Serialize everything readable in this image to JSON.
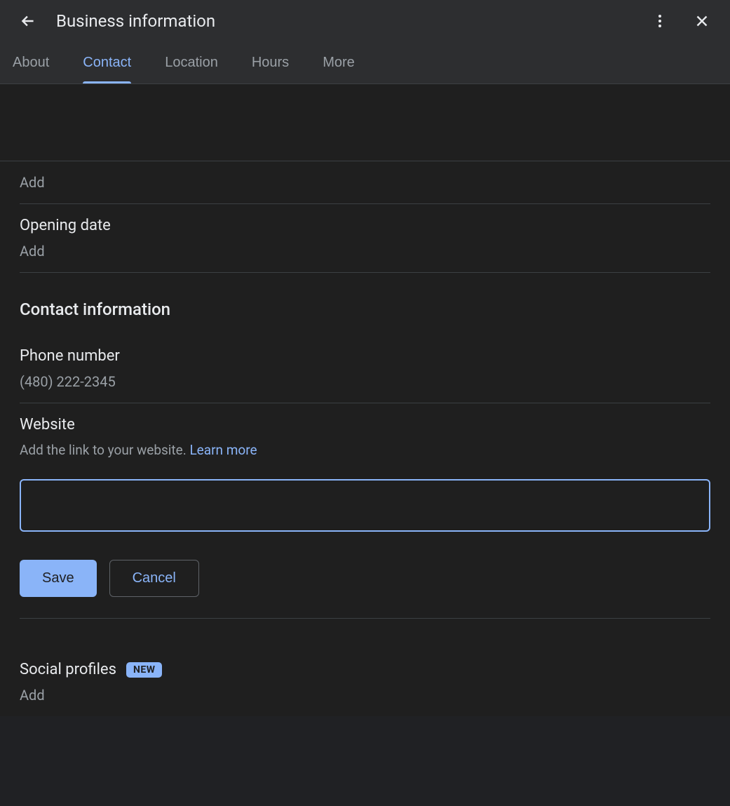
{
  "header": {
    "title": "Business information"
  },
  "tabs": {
    "about": "About",
    "contact": "Contact",
    "location": "Location",
    "hours": "Hours",
    "more": "More",
    "active": "contact"
  },
  "sections": {
    "top_add": "Add",
    "opening_date": {
      "label": "Opening date",
      "value": "Add"
    },
    "contact_info_heading": "Contact information",
    "phone": {
      "label": "Phone number",
      "value": "(480) 222-2345"
    },
    "website": {
      "label": "Website",
      "helper": "Add the link to your website. ",
      "learn_more": "Learn more",
      "input_value": ""
    },
    "buttons": {
      "save": "Save",
      "cancel": "Cancel"
    },
    "social": {
      "label": "Social profiles",
      "badge": "NEW",
      "value": "Add"
    }
  }
}
